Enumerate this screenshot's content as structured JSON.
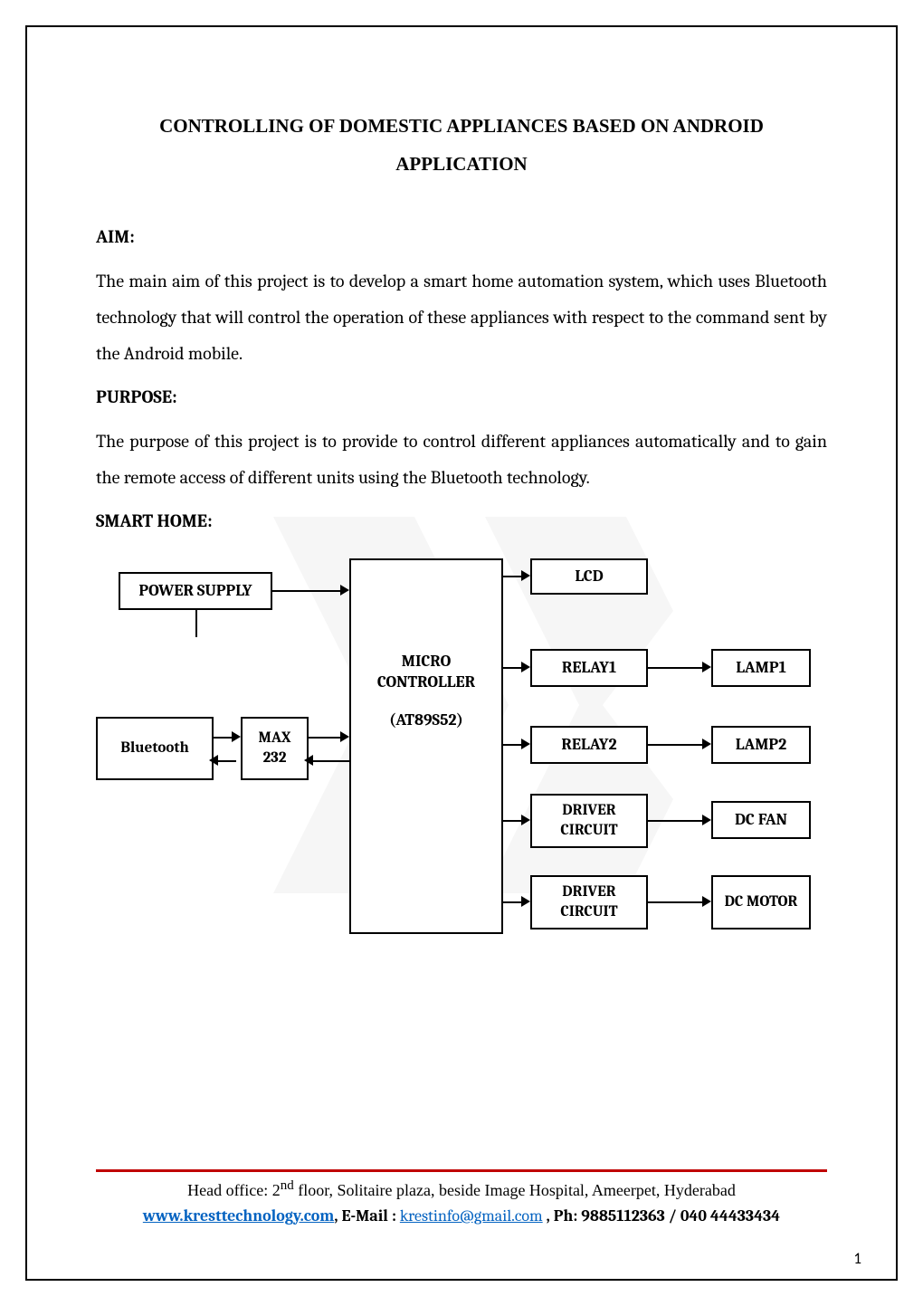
{
  "title": "CONTROLLING OF DOMESTIC APPLIANCES BASED ON ANDROID APPLICATION",
  "sections": {
    "aim": {
      "heading": "AIM:",
      "text": "The main aim of this project is to develop a smart home automation system, which uses Bluetooth technology that will control the operation of these appliances with respect to the command sent by the Android mobile."
    },
    "purpose": {
      "heading": "PURPOSE:",
      "text": "The purpose of this project is to provide to control different appliances automatically and to gain the remote access of different units using the Bluetooth technology."
    },
    "smarthome": {
      "heading": "SMART HOME:"
    }
  },
  "diagram": {
    "power_supply": "POWER SUPPLY",
    "bluetooth": "Bluetooth",
    "max232": "MAX 232",
    "mcu_line1": "MICRO CONTROLLER",
    "mcu_line2": "(AT89S52)",
    "lcd": "LCD",
    "relay1": "RELAY1",
    "relay2": "RELAY2",
    "driver1": "DRIVER CIRCUIT",
    "driver2": "DRIVER CIRCUIT",
    "lamp1": "LAMP1",
    "lamp2": "LAMP2",
    "dcfan": "DC FAN",
    "dcmotor": "DC MOTOR"
  },
  "footer": {
    "address_prefix": "Head office: 2",
    "address_sup": "nd",
    "address_suffix": " floor, Solitaire plaza, beside Image Hospital, Ameerpet, Hyderabad",
    "website": "www.kresttechnology.com",
    "email_label": ", E-Mail : ",
    "email": "krestinfo@gmail.com",
    "phone": "  , Ph: 9885112363 / 040 44433434"
  },
  "page_number": "1"
}
